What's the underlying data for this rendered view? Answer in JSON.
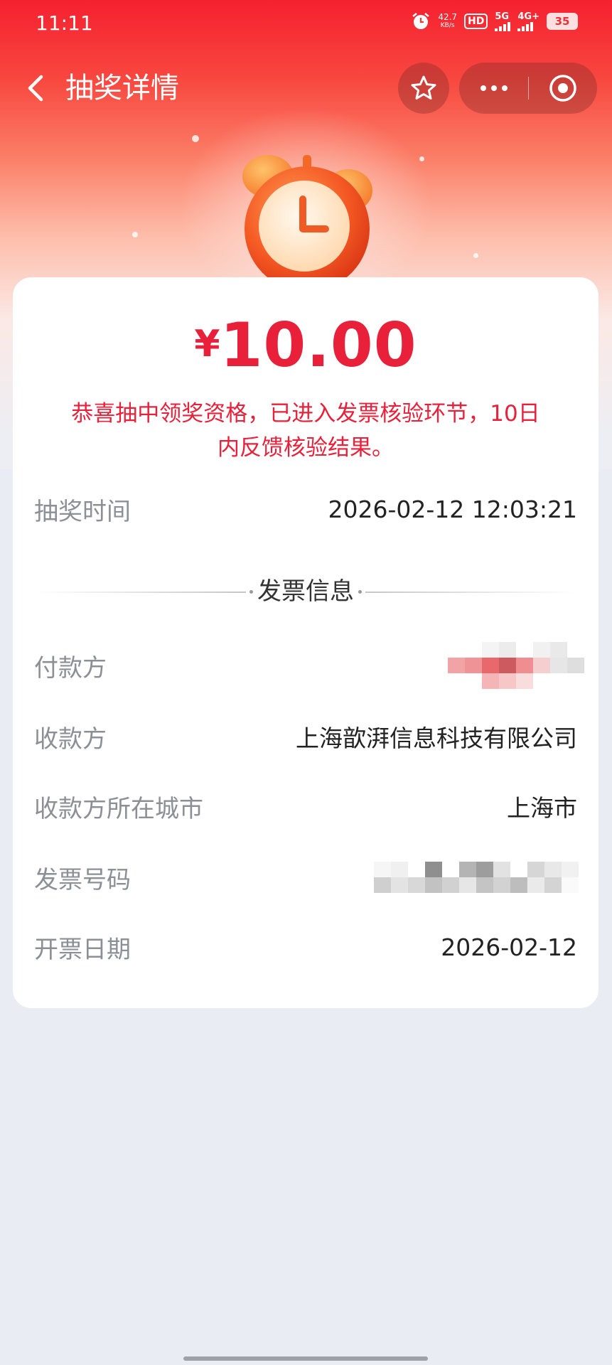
{
  "status_bar": {
    "time": "11:11",
    "net_speed": "42.7",
    "net_speed_unit": "KB/s",
    "hd_label": "HD",
    "signal_1": "5G",
    "signal_2": "4G+",
    "battery": "35"
  },
  "nav": {
    "title": "抽奖详情",
    "icons": [
      "back-arrow-icon",
      "star-icon",
      "more-dots-icon",
      "target-icon"
    ]
  },
  "prize": {
    "currency": "¥",
    "amount": "10.00",
    "message": "恭喜抽中领奖资格，已进入发票核验环节，10日内反馈核验结果。"
  },
  "draw": {
    "label": "抽奖时间",
    "value": "2026-02-12 12:03:21"
  },
  "invoice_section_title": "发票信息",
  "invoice": {
    "payer_label": "付款方",
    "payee_label": "收款方",
    "payee_value": "上海歆湃信息科技有限公司",
    "city_label": "收款方所在城市",
    "city_value": "上海市",
    "number_label": "发票号码",
    "date_label": "开票日期",
    "date_value": "2026-02-12"
  },
  "colors": {
    "primary_red": "#e8203a",
    "header_red": "#f5202f",
    "background": "#e9ecf3"
  }
}
